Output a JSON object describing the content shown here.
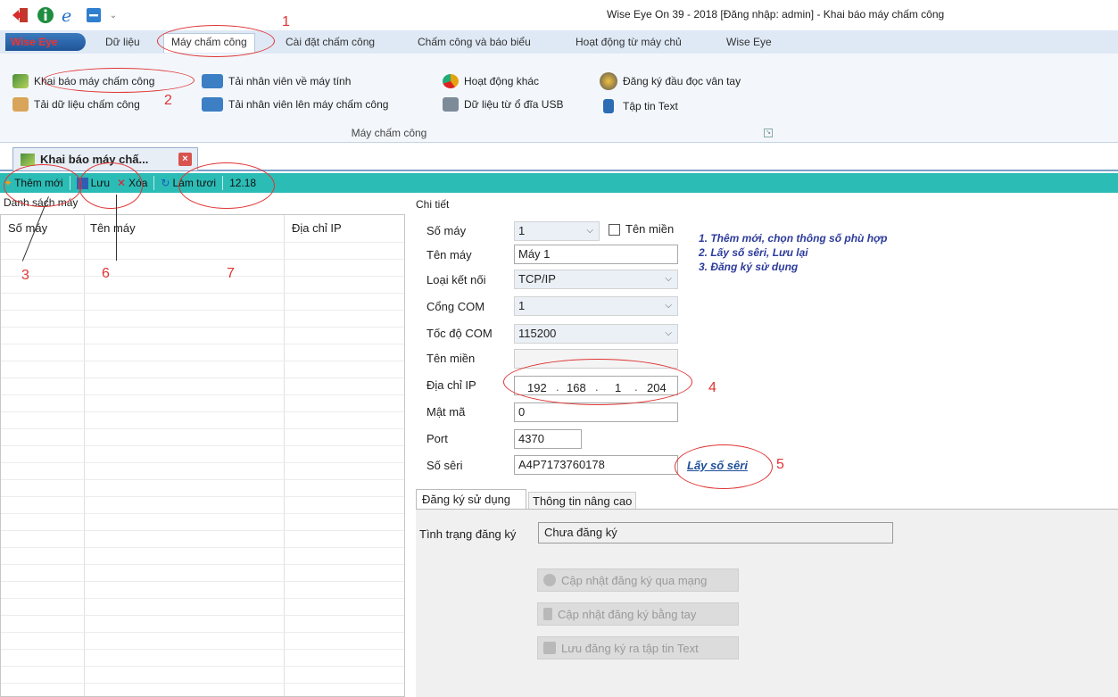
{
  "window": {
    "title": "Wise Eye On 39 - 2018 [Đăng nhập: admin] - Khai báo máy chấm công"
  },
  "menu": {
    "app_button": "Wise Eye",
    "tabs": [
      {
        "label": "Dữ liệu"
      },
      {
        "label": "Máy chấm công"
      },
      {
        "label": "Cài đặt chấm công"
      },
      {
        "label": "Chấm công và báo biểu"
      },
      {
        "label": "Hoạt động từ máy chủ"
      },
      {
        "label": "Wise Eye"
      }
    ]
  },
  "ribbon": {
    "group_label": "Máy chấm công",
    "items": [
      {
        "label": "Khai báo máy chấm công",
        "icon": "chart-icon"
      },
      {
        "label": "Tải dữ liệu chấm công",
        "icon": "box-icon"
      },
      {
        "label": "Tải nhân viên về máy tính",
        "icon": "users-down-icon"
      },
      {
        "label": "Tải nhân viên lên máy chấm công",
        "icon": "users-up-icon"
      },
      {
        "label": "Hoạt động khác",
        "icon": "pie-icon"
      },
      {
        "label": "Dữ liệu từ ổ đĩa USB",
        "icon": "usb-icon"
      },
      {
        "label": "Đăng ký đầu đọc vân tay",
        "icon": "fingerprint-icon"
      },
      {
        "label": "Tập tin Text",
        "icon": "text-file-icon"
      }
    ]
  },
  "document_tab": {
    "label": "Khai báo máy chấ...",
    "close": "×"
  },
  "toolbar": {
    "add": "Thêm mới",
    "save": "Lưu",
    "delete": "Xóa",
    "refresh": "Làm tươi",
    "version": "12.18"
  },
  "list": {
    "title": "Danh sách máy",
    "columns": [
      "Số máy",
      "Tên máy",
      "Địa chỉ IP"
    ]
  },
  "detail": {
    "title": "Chi tiết",
    "labels": {
      "machine_no": "Số máy",
      "machine_name": "Tên máy",
      "conn_type": "Loại kết nối",
      "com_port": "Cổng COM",
      "com_speed": "Tốc độ COM",
      "domain": "Tên miền",
      "ip": "Địa chỉ IP",
      "password": "Mật mã",
      "port": "Port",
      "serial": "Số sêri"
    },
    "values": {
      "machine_no": "1",
      "domain_checkbox": "Tên miền",
      "machine_name": "Máy 1",
      "conn_type": "TCP/IP",
      "com_port": "1",
      "com_speed": "115200",
      "domain": "",
      "ip_parts": [
        "192",
        "168",
        "1",
        "204"
      ],
      "password": "0",
      "port": "4370",
      "serial": "A4P7173760178"
    },
    "get_serial_link": "Lấy số sêri",
    "hints": [
      "1. Thêm mới, chọn thông số phù hợp",
      "2. Lấy số sêri, Lưu lại",
      "3. Đăng ký sử dụng"
    ],
    "sub_tabs": [
      "Đăng ký sử dụng",
      "Thông tin nâng cao"
    ],
    "registration_label": "Tình trạng đăng ký",
    "registration_status": "Chưa đăng ký",
    "buttons": [
      "Cập nhật đăng ký qua mạng",
      "Cập nhật đăng ký bằng tay",
      "Lưu đăng ký ra tập tin Text"
    ]
  },
  "annotations": [
    "1",
    "2",
    "3",
    "4",
    "5",
    "6",
    "7"
  ],
  "colors": {
    "toolbar_bg": "#2bbcb6",
    "annotation_red": "#e03434",
    "hint_blue": "#2d3b9b"
  }
}
